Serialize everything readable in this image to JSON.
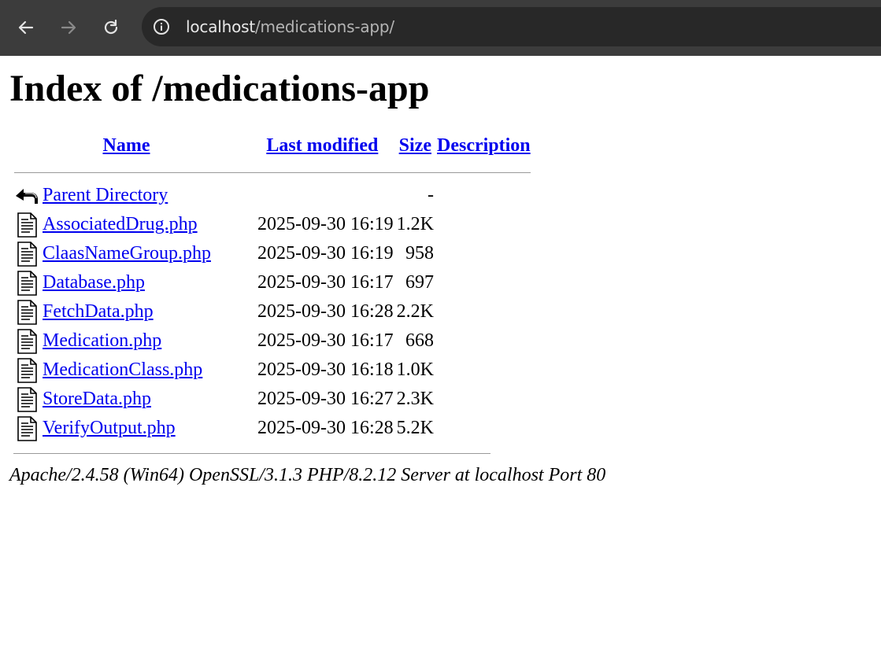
{
  "browser": {
    "url_host": "localhost",
    "url_path": "/medications-app/"
  },
  "page": {
    "title": "Index of /medications-app",
    "columns": {
      "name": "Name",
      "last_modified": "Last modified",
      "size": "Size",
      "description": "Description"
    },
    "parent": {
      "name": "Parent Directory",
      "size": "-",
      "icon": "back-icon"
    },
    "files": [
      {
        "name": "AssociatedDrug.php",
        "modified": "2025-09-30 16:19",
        "size": "1.2K",
        "icon": "text-file-icon"
      },
      {
        "name": "ClaasNameGroup.php",
        "modified": "2025-09-30 16:19",
        "size": "958",
        "icon": "text-file-icon"
      },
      {
        "name": "Database.php",
        "modified": "2025-09-30 16:17",
        "size": "697",
        "icon": "text-file-icon"
      },
      {
        "name": "FetchData.php",
        "modified": "2025-09-30 16:28",
        "size": "2.2K",
        "icon": "text-file-icon"
      },
      {
        "name": "Medication.php",
        "modified": "2025-09-30 16:17",
        "size": "668",
        "icon": "text-file-icon"
      },
      {
        "name": "MedicationClass.php",
        "modified": "2025-09-30 16:18",
        "size": "1.0K",
        "icon": "text-file-icon"
      },
      {
        "name": "StoreData.php",
        "modified": "2025-09-30 16:27",
        "size": "2.3K",
        "icon": "text-file-icon"
      },
      {
        "name": "VerifyOutput.php",
        "modified": "2025-09-30 16:28",
        "size": "5.2K",
        "icon": "text-file-icon"
      }
    ],
    "footer": "Apache/2.4.58 (Win64) OpenSSL/3.1.3 PHP/8.2.12 Server at localhost Port 80"
  },
  "colors": {
    "link": "#0000ee",
    "chrome_bg": "#3c3c3c",
    "omnibox_bg": "#282828"
  }
}
